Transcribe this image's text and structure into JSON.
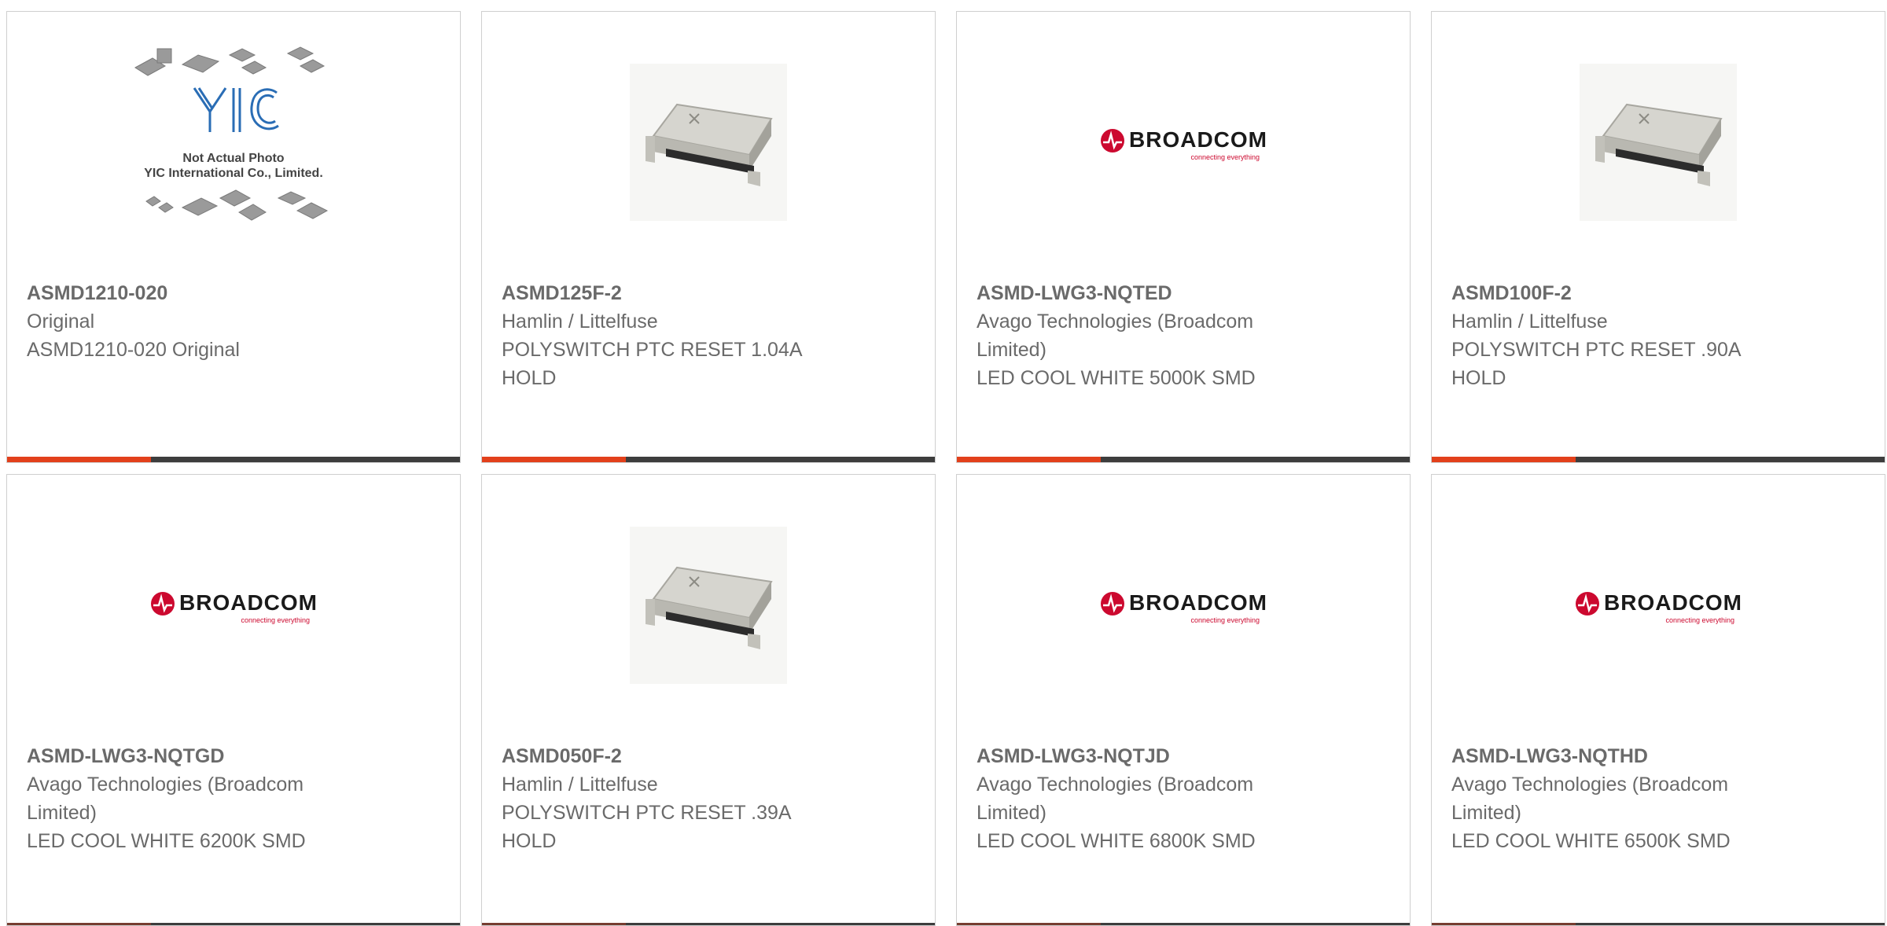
{
  "products": [
    {
      "part_number": "ASMD1210-020",
      "manufacturer": "Original",
      "description": "ASMD1210-020 Original",
      "image": "yic-placeholder",
      "image_caption_line1": "Not Actual Photo",
      "image_caption_line2": "YIC International Co., Limited.",
      "image_logo_text": "YIC"
    },
    {
      "part_number": "ASMD125F-2",
      "manufacturer": "Hamlin / Littelfuse",
      "description": "POLYSWITCH PTC RESET 1.04A HOLD",
      "image": "ptc-chip"
    },
    {
      "part_number": "ASMD-LWG3-NQTED",
      "manufacturer": "Avago Technologies (Broadcom Limited)",
      "description": "LED COOL WHITE 5000K SMD",
      "image": "broadcom-logo"
    },
    {
      "part_number": "ASMD100F-2",
      "manufacturer": "Hamlin / Littelfuse",
      "description": "POLYSWITCH PTC RESET .90A HOLD",
      "image": "ptc-chip"
    },
    {
      "part_number": "ASMD-LWG3-NQTGD",
      "manufacturer": "Avago Technologies (Broadcom Limited)",
      "description": "LED COOL WHITE 6200K SMD",
      "image": "broadcom-logo"
    },
    {
      "part_number": "ASMD050F-2",
      "manufacturer": "Hamlin / Littelfuse",
      "description": "POLYSWITCH PTC RESET .39A HOLD",
      "image": "ptc-chip"
    },
    {
      "part_number": "ASMD-LWG3-NQTJD",
      "manufacturer": "Avago Technologies (Broadcom Limited)",
      "description": "LED COOL WHITE 6800K SMD",
      "image": "broadcom-logo"
    },
    {
      "part_number": "ASMD-LWG3-NQTHD",
      "manufacturer": "Avago Technologies (Broadcom Limited)",
      "description": "LED COOL WHITE 6500K SMD",
      "image": "broadcom-logo"
    }
  ],
  "broadcom_logo": {
    "wordmark": "BROADCOM",
    "tagline": "connecting everything"
  },
  "colors": {
    "accent": "#e2401b",
    "bar": "#3d3d3d",
    "text": "#6a6a6a",
    "border": "#cfcfcf",
    "broadcom_red": "#cc092f"
  }
}
